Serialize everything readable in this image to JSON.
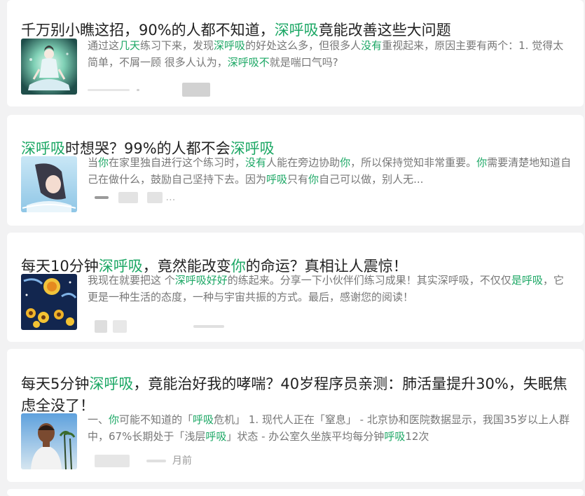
{
  "articles": [
    {
      "title": [
        {
          "t": "千万别小瞧这招，90%的人都不知道，",
          "h": false
        },
        {
          "t": "深呼吸",
          "h": true
        },
        {
          "t": "竟能改善这些大问题",
          "h": false
        }
      ],
      "snippet": [
        {
          "t": "通过这",
          "h": false
        },
        {
          "t": "几天",
          "h": true
        },
        {
          "t": "练习下来，发现",
          "h": false
        },
        {
          "t": "深呼吸",
          "h": true
        },
        {
          "t": "的好处这么多，但很多人",
          "h": false
        },
        {
          "t": "没有",
          "h": true
        },
        {
          "t": "重视起来，原因主要有两个：1. 觉得太简单，不屑一顾 很多人认为，",
          "h": false
        },
        {
          "t": "深呼吸不",
          "h": true
        },
        {
          "t": "就是喘口气吗?",
          "h": false
        }
      ],
      "meta": "",
      "thumb_icon": "meditation-figure-image"
    },
    {
      "title": [
        {
          "t": "深呼吸",
          "h": true
        },
        {
          "t": "时想哭？99%的人都不会",
          "h": false
        },
        {
          "t": "深呼吸",
          "h": true
        }
      ],
      "snippet": [
        {
          "t": "当",
          "h": false
        },
        {
          "t": "你",
          "h": true
        },
        {
          "t": "在家里独自进行这个练习时，",
          "h": false
        },
        {
          "t": "没有",
          "h": true
        },
        {
          "t": "人能在旁边协助",
          "h": false
        },
        {
          "t": "你",
          "h": true
        },
        {
          "t": "，所以保持觉知非常重要。",
          "h": false
        },
        {
          "t": "你",
          "h": true
        },
        {
          "t": "需要清楚地知道自己在做什么，鼓励自己坚持下去。因为",
          "h": false
        },
        {
          "t": "呼吸",
          "h": true
        },
        {
          "t": "只有",
          "h": false
        },
        {
          "t": "你",
          "h": true
        },
        {
          "t": "自己可以做，别人无...",
          "h": false
        }
      ],
      "meta": "…",
      "thumb_icon": "crying-woman-image"
    },
    {
      "title": [
        {
          "t": "每天10分钟",
          "h": false
        },
        {
          "t": "深呼吸",
          "h": true
        },
        {
          "t": "，竟然能改变",
          "h": false
        },
        {
          "t": "你",
          "h": true
        },
        {
          "t": "的命运？真相让人震惊！",
          "h": false
        }
      ],
      "snippet": [
        {
          "t": "我现在就要把这 个",
          "h": false
        },
        {
          "t": "深呼吸好好",
          "h": true
        },
        {
          "t": "的练起来。分享一下小伙伴们练习成果！其实深呼吸，不仅仅",
          "h": false
        },
        {
          "t": "是呼吸",
          "h": true
        },
        {
          "t": "，它更是一种生活的态度，一种与宇宙共振的方式。最后，感谢您的阅读！",
          "h": false
        }
      ],
      "meta": "",
      "thumb_icon": "starry-sunflower-image"
    },
    {
      "title": [
        {
          "t": "每天5分钟",
          "h": false
        },
        {
          "t": "深呼吸",
          "h": true
        },
        {
          "t": "，竟能治好我的哮喘？40岁程序员亲测：肺活量提升30%，失眠焦虑全没了！",
          "h": false
        }
      ],
      "snippet": [
        {
          "t": "一、",
          "h": false
        },
        {
          "t": "你",
          "h": true
        },
        {
          "t": "可能不知道的「",
          "h": false
        },
        {
          "t": "呼吸",
          "h": true
        },
        {
          "t": "危机」 1. 现代人正在「窒息」 - 北京协和医院数据显示，我国35岁以上人群中，67%长期处于「浅层",
          "h": false
        },
        {
          "t": "呼吸",
          "h": true
        },
        {
          "t": "」状态 - 办公室久坐族平均每分钟",
          "h": false
        },
        {
          "t": "呼吸",
          "h": true
        },
        {
          "t": "12次",
          "h": false
        }
      ],
      "meta": "月前",
      "thumb_icon": "man-breathing-image"
    }
  ],
  "colors": {
    "highlight": "#1ba764",
    "title": "#222222",
    "snippet": "#777777",
    "background": "#f2f2f3"
  }
}
